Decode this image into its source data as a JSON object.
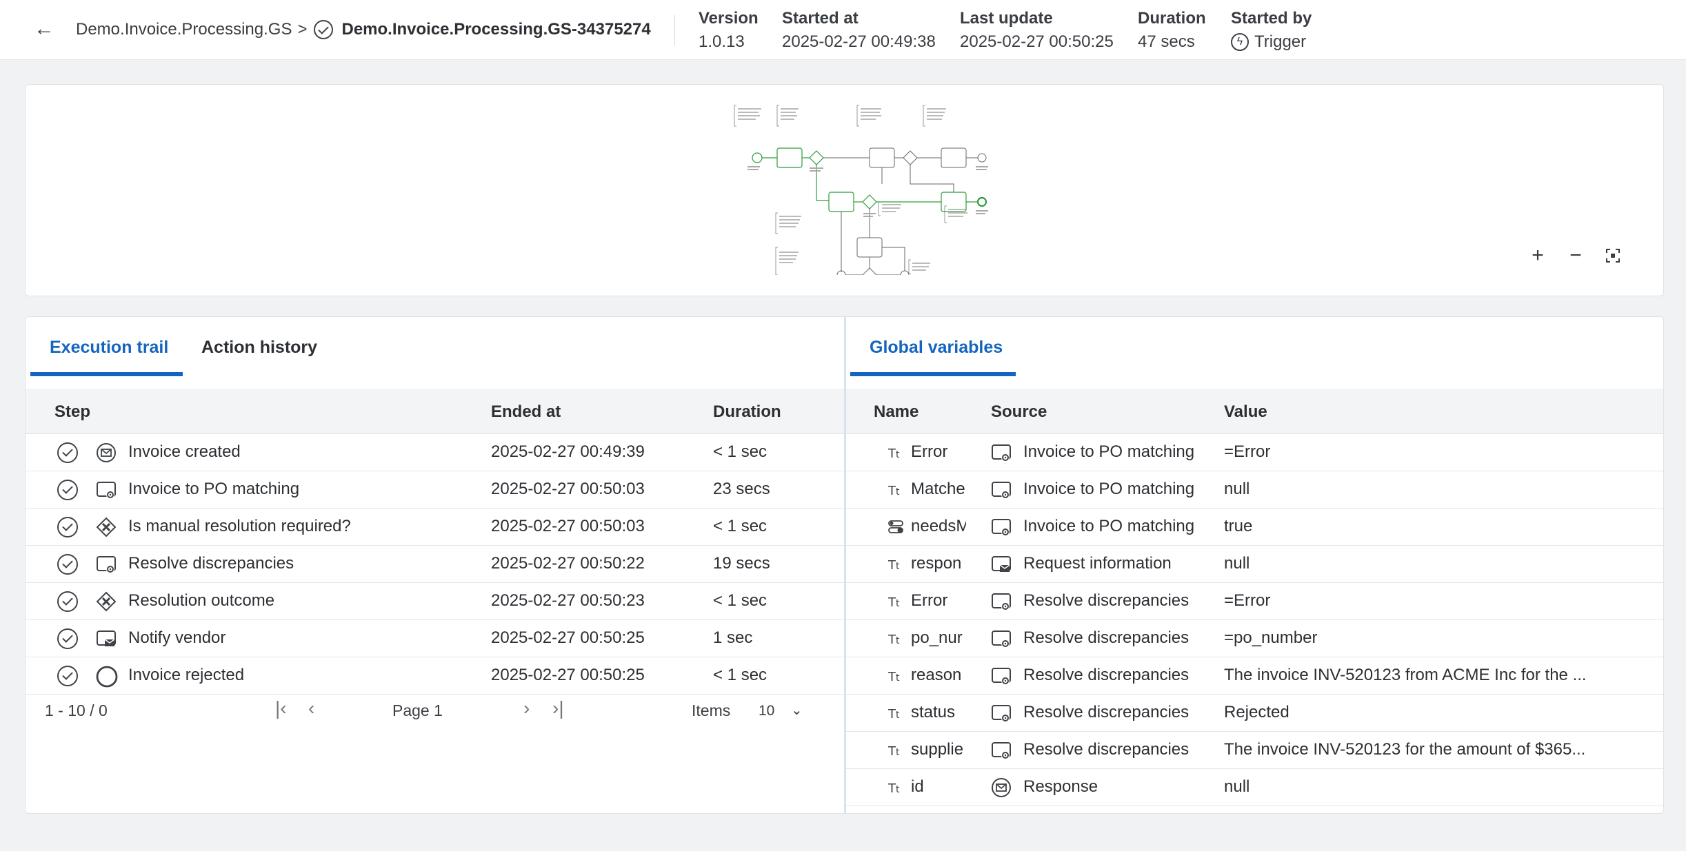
{
  "header": {
    "back_icon": "arrow-left-icon",
    "breadcrumb_parent": "Demo.Invoice.Processing.GS",
    "breadcrumb_sep": ">",
    "status_icon": "check-circle-icon",
    "breadcrumb_current": "Demo.Invoice.Processing.GS-34375274",
    "version_label": "Version",
    "version_value": "1.0.13",
    "started_label": "Started at",
    "started_value": "2025-02-27 00:49:38",
    "update_label": "Last update",
    "update_value": "2025-02-27 00:50:25",
    "duration_label": "Duration",
    "duration_value": "47 secs",
    "startedby_label": "Started by",
    "startedby_value": "Trigger",
    "startedby_icon": "lightning-bolt-icon"
  },
  "diagram": {
    "zoom_in": "+",
    "zoom_out": "−",
    "fit_icon": "fit-screen-icon",
    "accent_color": "#2e9b3a"
  },
  "trail": {
    "tabs": [
      {
        "label": "Execution trail",
        "active": true
      },
      {
        "label": "Action history",
        "active": false
      }
    ],
    "columns": [
      "Step",
      "Ended at",
      "Duration"
    ],
    "rows": [
      {
        "status_icon": "check-circle-icon",
        "type_icon": "message-event-icon",
        "step": "Invoice created",
        "ended": "2025-02-27 00:49:39",
        "duration": "< 1 sec"
      },
      {
        "status_icon": "check-circle-icon",
        "type_icon": "service-task-icon",
        "step": "Invoice to PO matching",
        "ended": "2025-02-27 00:50:03",
        "duration": "23 secs"
      },
      {
        "status_icon": "check-circle-icon",
        "type_icon": "exclusive-gateway-icon",
        "step": "Is manual resolution required?",
        "ended": "2025-02-27 00:50:03",
        "duration": "< 1 sec"
      },
      {
        "status_icon": "check-circle-icon",
        "type_icon": "service-task-icon",
        "step": "Resolve discrepancies",
        "ended": "2025-02-27 00:50:22",
        "duration": "19 secs"
      },
      {
        "status_icon": "check-circle-icon",
        "type_icon": "exclusive-gateway-icon",
        "step": "Resolution outcome",
        "ended": "2025-02-27 00:50:23",
        "duration": "< 1 sec"
      },
      {
        "status_icon": "check-circle-icon",
        "type_icon": "send-task-icon",
        "step": "Notify vendor",
        "ended": "2025-02-27 00:50:25",
        "duration": "1 sec"
      },
      {
        "status_icon": "check-circle-icon",
        "type_icon": "end-event-icon",
        "step": "Invoice rejected",
        "ended": "2025-02-27 00:50:25",
        "duration": "< 1 sec"
      }
    ],
    "pager": {
      "range": "1 - 10 / 0",
      "page": "Page 1",
      "items_label": "Items",
      "items_value": "10"
    }
  },
  "vars": {
    "tabs": [
      {
        "label": "Global variables",
        "active": true
      }
    ],
    "columns": [
      "Name",
      "Source",
      "Value"
    ],
    "rows": [
      {
        "type_icon": "text-type-icon",
        "name": "Error",
        "source_icon": "service-task-icon",
        "source": "Invoice to PO matching",
        "value": "=Error"
      },
      {
        "type_icon": "text-type-icon",
        "name": "Matche",
        "source_icon": "service-task-icon",
        "source": "Invoice to PO matching",
        "value": "null"
      },
      {
        "type_icon": "boolean-type-icon",
        "name": "needsM",
        "source_icon": "service-task-icon",
        "source": "Invoice to PO matching",
        "value": "true"
      },
      {
        "type_icon": "text-type-icon",
        "name": "respon",
        "source_icon": "send-task-icon",
        "source": "Request information",
        "value": "null"
      },
      {
        "type_icon": "text-type-icon",
        "name": "Error",
        "source_icon": "service-task-icon",
        "source": "Resolve discrepancies",
        "value": "=Error"
      },
      {
        "type_icon": "text-type-icon",
        "name": "po_nur",
        "source_icon": "service-task-icon",
        "source": "Resolve discrepancies",
        "value": "=po_number"
      },
      {
        "type_icon": "text-type-icon",
        "name": "reason",
        "source_icon": "service-task-icon",
        "source": "Resolve discrepancies",
        "value": "The invoice INV-520123 from ACME Inc for the ..."
      },
      {
        "type_icon": "text-type-icon",
        "name": "status",
        "source_icon": "service-task-icon",
        "source": "Resolve discrepancies",
        "value": "Rejected"
      },
      {
        "type_icon": "text-type-icon",
        "name": "supplie",
        "source_icon": "service-task-icon",
        "source": "Resolve discrepancies",
        "value": "The invoice INV-520123 for the amount of $365..."
      },
      {
        "type_icon": "text-type-icon",
        "name": "id",
        "source_icon": "message-event-icon",
        "source": "Response",
        "value": "null"
      }
    ]
  }
}
